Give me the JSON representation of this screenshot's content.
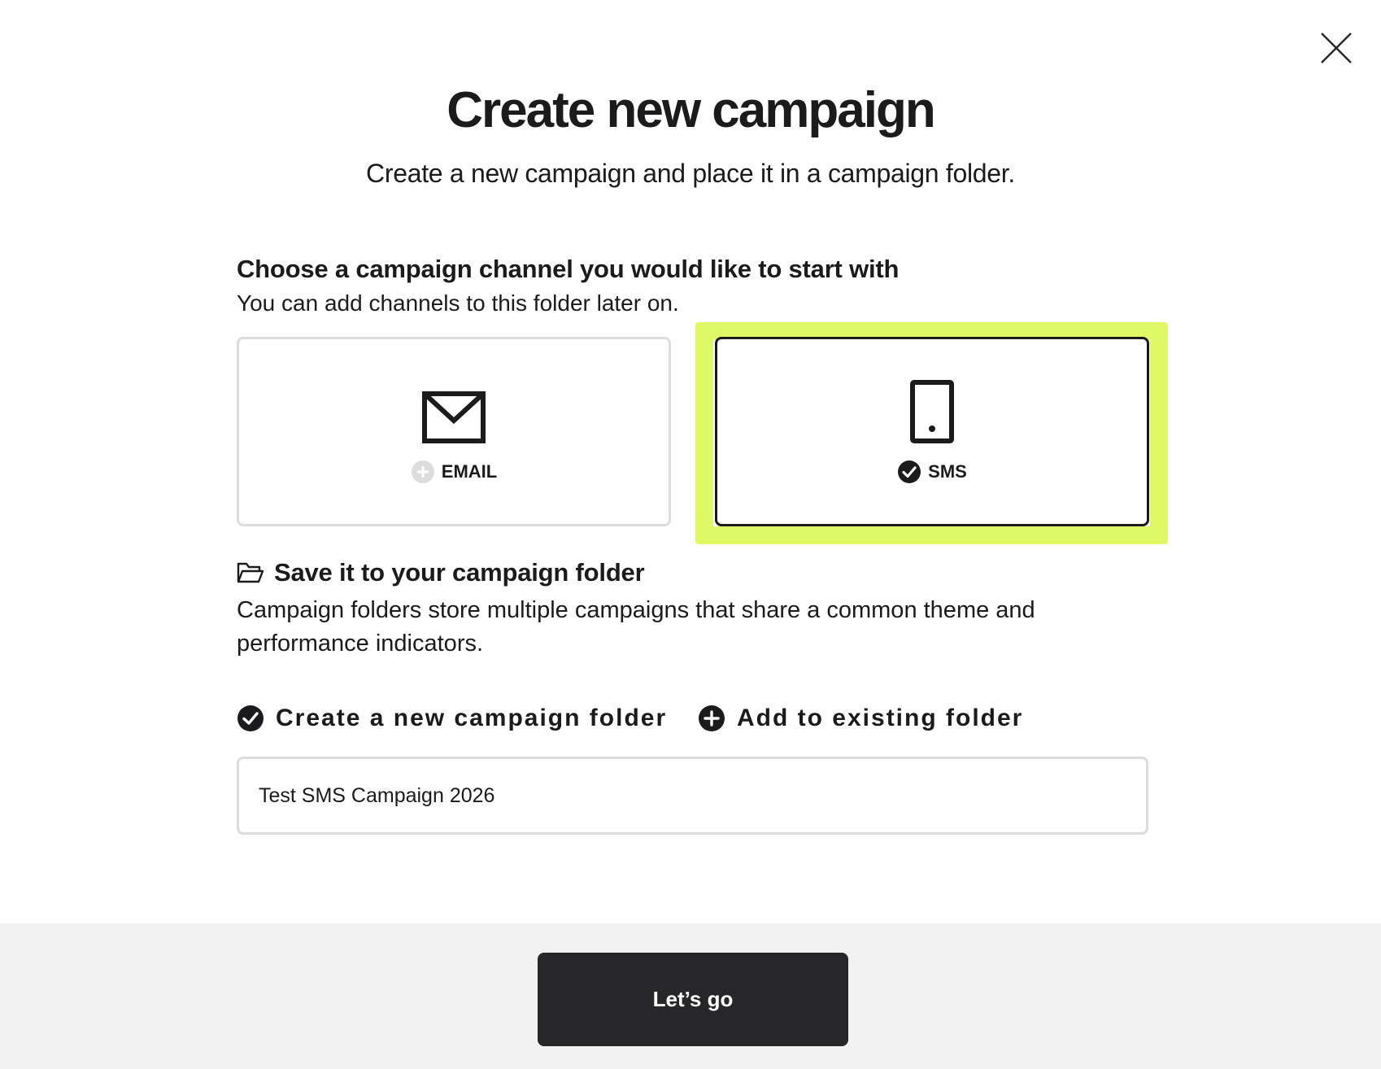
{
  "header": {
    "title": "Create new campaign",
    "subtitle": "Create a new campaign and place it in a campaign folder."
  },
  "channel_section": {
    "heading": "Choose a campaign channel you would like to start with",
    "subheading": "You can add channels to this folder later on.",
    "channels": [
      {
        "label": "EMAIL",
        "icon": "envelope-icon",
        "status_icon": "plus-circle-icon",
        "selected": false
      },
      {
        "label": "SMS",
        "icon": "mobile-phone-icon",
        "status_icon": "check-circle-icon",
        "selected": true
      }
    ]
  },
  "folder_section": {
    "icon": "folder-open-icon",
    "heading": "Save it to your campaign folder",
    "description": "Campaign folders store multiple campaigns that share a common theme and performance indicators.",
    "options": [
      {
        "label": "Create a new campaign folder",
        "icon": "check-circle-icon",
        "selected": true
      },
      {
        "label": "Add to existing folder",
        "icon": "plus-circle-icon",
        "selected": false
      }
    ],
    "folder_name_value": "Test SMS Campaign 2026"
  },
  "footer": {
    "primary_button": "Let’s go"
  },
  "colors": {
    "highlight": "#dff966",
    "primary_button_bg": "#272729",
    "footer_bg": "#f2f2f2",
    "card_border": "#dcdcdc",
    "selected_border": "#1b1b1d"
  }
}
